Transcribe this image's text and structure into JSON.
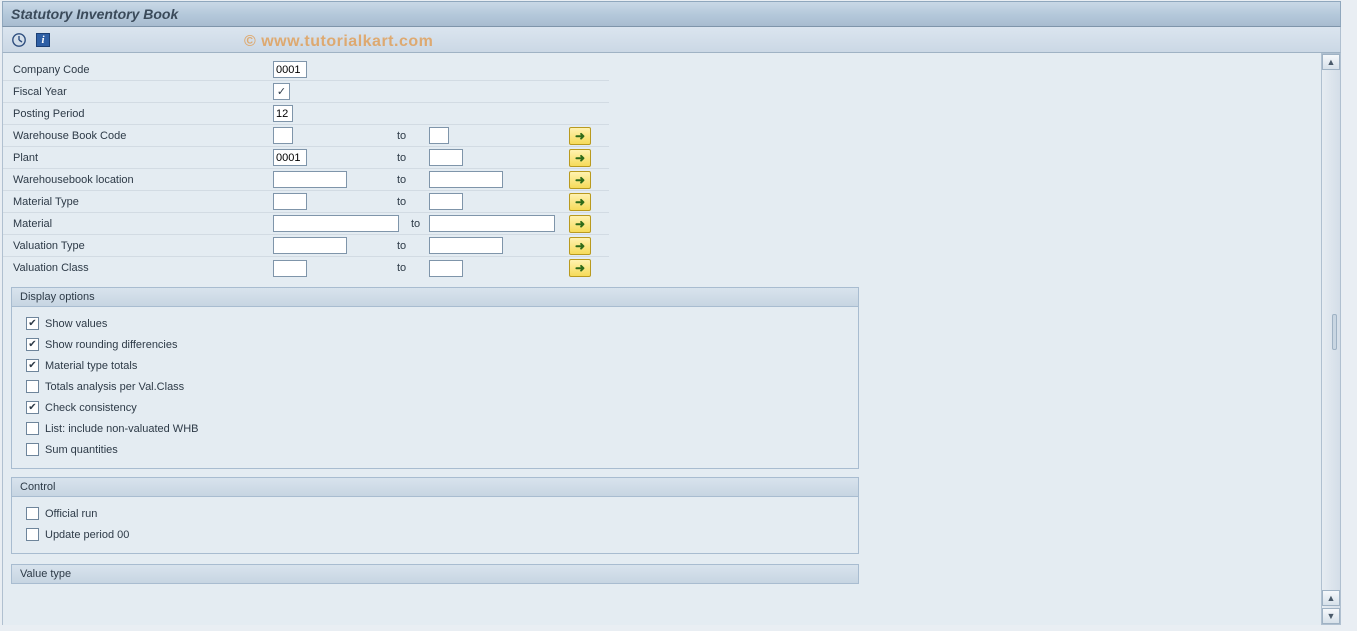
{
  "title": "Statutory Inventory Book",
  "watermark": "© www.tutorialkart.com",
  "toolbar": {
    "execute_tooltip": "Execute",
    "info_tooltip": "Information"
  },
  "fields": {
    "company_code": {
      "label": "Company Code",
      "value": "0001"
    },
    "fiscal_year": {
      "label": "Fiscal Year"
    },
    "posting_period": {
      "label": "Posting Period",
      "value": "12"
    },
    "whb_code": {
      "label": "Warehouse Book Code",
      "from": "",
      "to_label": "to",
      "to": ""
    },
    "plant": {
      "label": "Plant",
      "from": "0001",
      "to_label": "to",
      "to": ""
    },
    "whb_location": {
      "label": "Warehousebook  location",
      "from": "",
      "to_label": "to",
      "to": ""
    },
    "material_type": {
      "label": "Material Type",
      "from": "",
      "to_label": "to",
      "to": ""
    },
    "material": {
      "label": "Material",
      "from": "",
      "to_label": "to",
      "to": ""
    },
    "valuation_type": {
      "label": "Valuation Type",
      "from": "",
      "to_label": "to",
      "to": ""
    },
    "valuation_class": {
      "label": "Valuation Class",
      "from": "",
      "to_label": "to",
      "to": ""
    }
  },
  "groups": {
    "display": {
      "title": "Display options",
      "items": [
        {
          "label": "Show values",
          "checked": true
        },
        {
          "label": "Show rounding differencies",
          "checked": true
        },
        {
          "label": "Material type totals",
          "checked": true
        },
        {
          "label": "Totals analysis per Val.Class",
          "checked": false
        },
        {
          "label": "Check consistency",
          "checked": true
        },
        {
          "label": "List: include non-valuated WHB",
          "checked": false
        },
        {
          "label": "Sum quantities",
          "checked": false
        }
      ]
    },
    "control": {
      "title": "Control",
      "items": [
        {
          "label": "Official run",
          "checked": false
        },
        {
          "label": "Update period 00",
          "checked": false
        }
      ]
    },
    "value_type": {
      "title": "Value type"
    }
  }
}
